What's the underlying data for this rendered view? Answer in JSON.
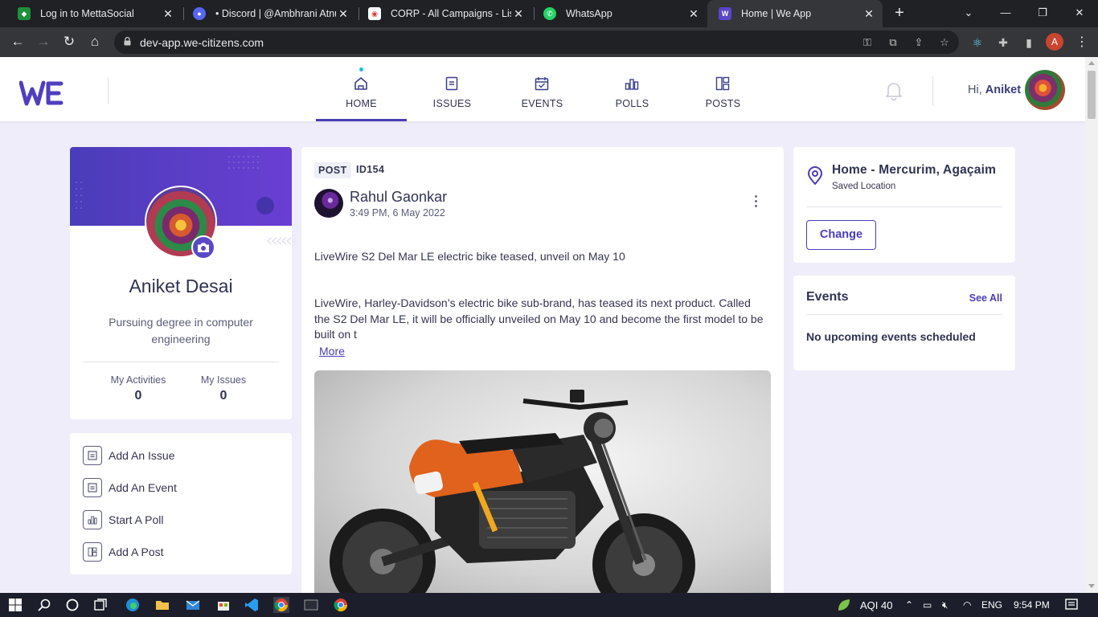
{
  "browser": {
    "tabs": [
      {
        "title": "Log in to MettaSocial",
        "favicon_color": "#1e8f3a"
      },
      {
        "title": "• Discord | @Ambhrani Atnur",
        "favicon_color": "#5865f2"
      },
      {
        "title": "CORP - All Campaigns - List |",
        "favicon_color": "#d93a3a"
      },
      {
        "title": "WhatsApp",
        "favicon_color": "#25d366"
      },
      {
        "title": "Home | We App",
        "favicon_color": "#5b45c9"
      }
    ],
    "url": "dev-app.we-citizens.com",
    "profile_initial": "A"
  },
  "header": {
    "logo_text": "WE",
    "nav": [
      {
        "label": "HOME",
        "icon": "home-icon",
        "active": true
      },
      {
        "label": "ISSUES",
        "icon": "issues-icon"
      },
      {
        "label": "EVENTS",
        "icon": "events-icon"
      },
      {
        "label": "POLLS",
        "icon": "polls-icon"
      },
      {
        "label": "POSTS",
        "icon": "posts-icon"
      }
    ],
    "greeting_prefix": "Hi,",
    "user_first_name": "Aniket"
  },
  "profile": {
    "name": "Aniket Desai",
    "bio": "Pursuing degree in computer engineering",
    "stats": [
      {
        "label": "My Activities",
        "value": "0"
      },
      {
        "label": "My Issues",
        "value": "0"
      }
    ]
  },
  "actions": [
    {
      "label": "Add An Issue",
      "icon": "issue-icon"
    },
    {
      "label": "Add An Event",
      "icon": "event-icon"
    },
    {
      "label": "Start A Poll",
      "icon": "poll-icon"
    },
    {
      "label": "Add A Post",
      "icon": "post-icon"
    }
  ],
  "post": {
    "tag": "POST",
    "id": "ID154",
    "author": "Rahul Gaonkar",
    "time": "3:49 PM, 6 May 2022",
    "headline": "LiveWire S2 Del Mar LE electric bike teased, unveil on May 10",
    "body": "LiveWire, Harley-Davidson’s electric bike sub-brand, has teased its next product. Called the S2 Del Mar LE, it will be officially unveiled on May 10 and become the first model to be built on t",
    "more_label": "More",
    "image_subject": "orange-black-electric-motorcycle"
  },
  "location": {
    "name": "Home - Mercurim, Agaçaim",
    "subtitle": "Saved Location",
    "change_label": "Change"
  },
  "events": {
    "title": "Events",
    "see_all": "See All",
    "empty_text": "No upcoming events scheduled"
  },
  "taskbar": {
    "aqi": "AQI 40",
    "lang": "ENG",
    "time": "9:54 PM"
  },
  "colors": {
    "brand": "#4a3eb5",
    "background": "#eeedf9",
    "banner": "#5a40c8"
  }
}
